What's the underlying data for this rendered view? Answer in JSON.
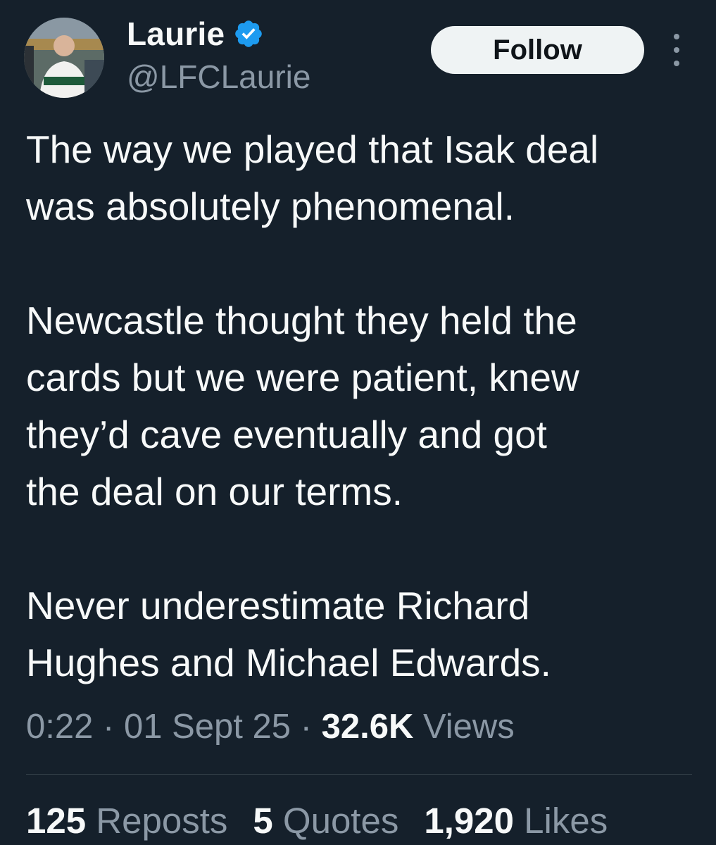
{
  "author": {
    "display_name": "Laurie",
    "handle": "@LFCLaurie",
    "verified_icon": "verified-badge-icon",
    "verified_color": "#1d9bf0"
  },
  "actions": {
    "follow_label": "Follow",
    "more_icon": "more-vertical-icon"
  },
  "tweet": {
    "paragraphs": [
      [
        "The way we played that Isak deal",
        "was absolutely phenomenal."
      ],
      [
        "Newcastle thought they held the",
        "cards but we were patient, knew",
        "they’d cave eventually and got",
        "the deal on our terms."
      ],
      [
        "Never underestimate Richard",
        "Hughes and Michael Edwards."
      ]
    ]
  },
  "meta": {
    "time": "0:22",
    "separator": "·",
    "date": "01 Sept 25",
    "views_count": "32.6K",
    "views_label": "Views"
  },
  "stats": {
    "reposts_count": "125",
    "reposts_label": "Reposts",
    "quotes_count": "5",
    "quotes_label": "Quotes",
    "likes_count": "1,920",
    "likes_label": "Likes"
  },
  "colors": {
    "background": "#15202b",
    "primary_text": "#f7f9f9",
    "secondary_text": "#8b98a5",
    "follow_button_bg": "#eff3f4",
    "divider": "#38444d"
  }
}
